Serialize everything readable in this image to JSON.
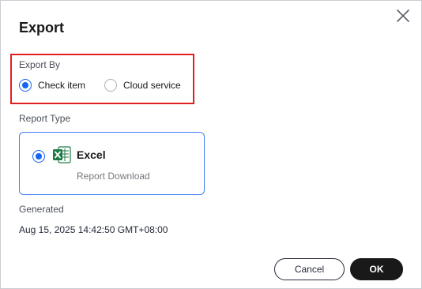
{
  "dialog": {
    "title": "Export"
  },
  "export_by": {
    "label": "Export By",
    "options": [
      {
        "label": "Check item",
        "selected": true
      },
      {
        "label": "Cloud service",
        "selected": false
      }
    ]
  },
  "report_type": {
    "label": "Report Type",
    "card": {
      "icon": "excel-icon",
      "title": "Excel",
      "subtitle": "Report Download",
      "selected": true
    }
  },
  "generated": {
    "label": "Generated",
    "value": "Aug 15, 2025 14:42:50 GMT+08:00"
  },
  "footer": {
    "cancel_label": "Cancel",
    "ok_label": "OK"
  },
  "colors": {
    "accent": "#1466f5",
    "highlight": "#e02020",
    "excel_green": "#1d7a45",
    "primary_button": "#191919"
  }
}
